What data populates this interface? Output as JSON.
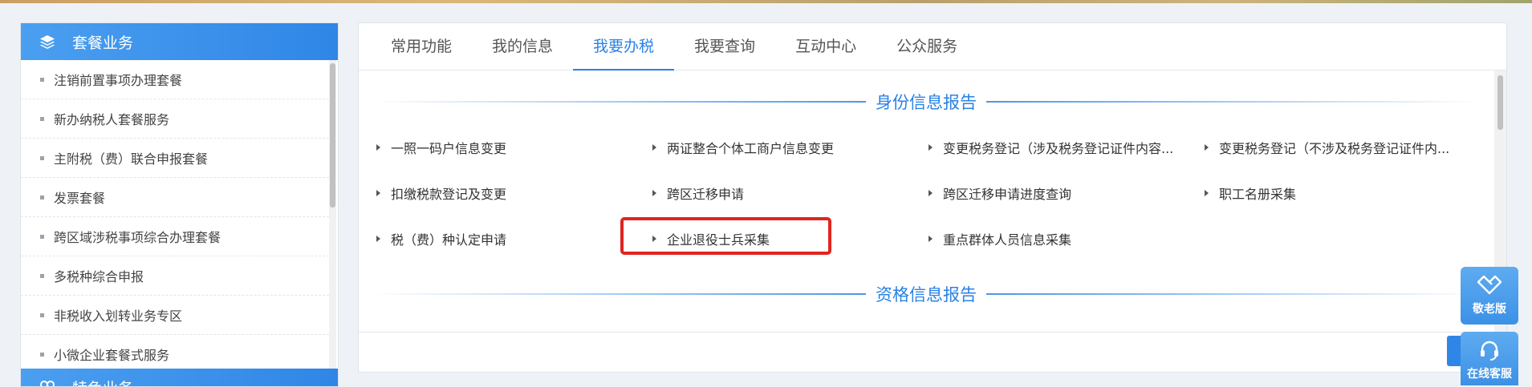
{
  "sidebar": {
    "panel1_title": "套餐业务",
    "panel2_title": "特色业务",
    "items": [
      {
        "label": "注销前置事项办理套餐"
      },
      {
        "label": "新办纳税人套餐服务"
      },
      {
        "label": "主附税（费）联合申报套餐"
      },
      {
        "label": "发票套餐"
      },
      {
        "label": "跨区域涉税事项综合办理套餐"
      },
      {
        "label": "多税种综合申报"
      },
      {
        "label": "非税收入划转业务专区"
      },
      {
        "label": "小微企业套餐式服务"
      }
    ]
  },
  "tabs": [
    {
      "label": "常用功能"
    },
    {
      "label": "我的信息"
    },
    {
      "label": "我要办税",
      "active": true
    },
    {
      "label": "我要查询"
    },
    {
      "label": "互动中心"
    },
    {
      "label": "公众服务"
    }
  ],
  "sections": [
    {
      "title": "身份信息报告",
      "items": [
        "一照一码户信息变更",
        "两证整合个体工商户信息变更",
        "变更税务登记（涉及税务登记证件内容...",
        "变更税务登记（不涉及税务登记证件内...",
        "扣缴税款登记及变更",
        "跨区迁移申请",
        "跨区迁移申请进度查询",
        "职工名册采集",
        "税（费）种认定申请",
        "企业退役士兵采集",
        "重点群体人员信息采集"
      ]
    },
    {
      "title": "资格信息报告",
      "items": []
    }
  ],
  "float_buttons": {
    "elder_mode": "敬老版",
    "online_service": "在线客服"
  },
  "colors": {
    "accent": "#2a82e4",
    "highlight": "#e02520"
  }
}
